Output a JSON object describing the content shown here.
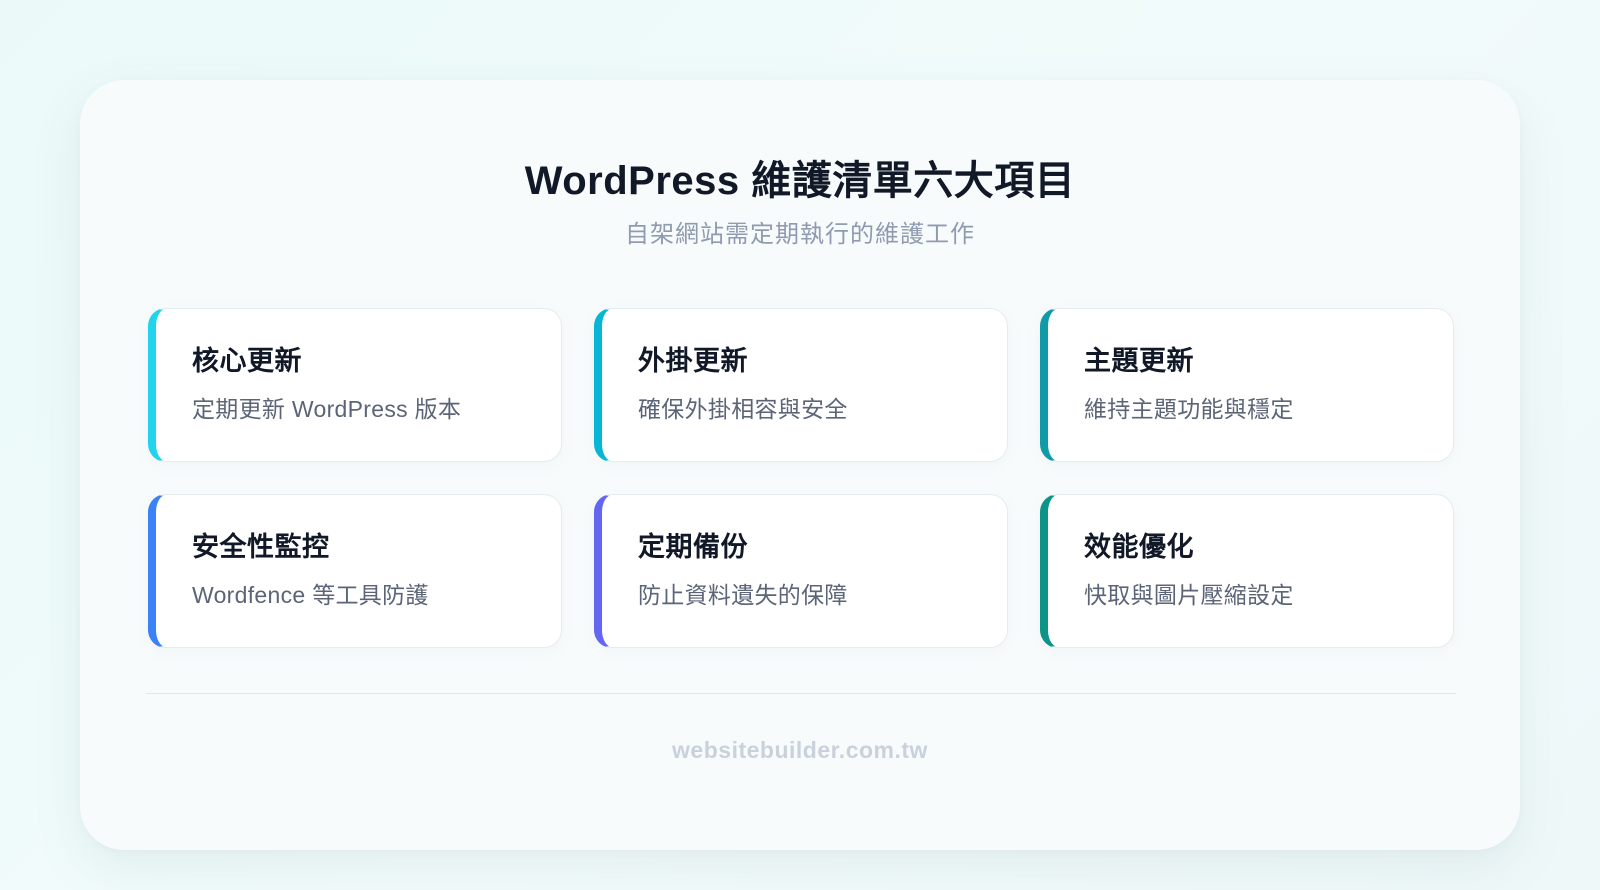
{
  "header": {
    "title": "WordPress 維護清單六大項目",
    "subtitle": "自架網站需定期執行的維護工作"
  },
  "cards": [
    {
      "title": "核心更新",
      "description": "定期更新 WordPress 版本",
      "accent": "#22d3ee"
    },
    {
      "title": "外掛更新",
      "description": "確保外掛相容與安全",
      "accent": "#06b6d4"
    },
    {
      "title": "主題更新",
      "description": "維持主題功能與穩定",
      "accent": "#0e9aa7"
    },
    {
      "title": "安全性監控",
      "description": "Wordfence 等工具防護",
      "accent": "#3b82f6"
    },
    {
      "title": "定期備份",
      "description": "防止資料遺失的保障",
      "accent": "#6366f1"
    },
    {
      "title": "效能優化",
      "description": "快取與圖片壓縮設定",
      "accent": "#0d9488"
    }
  ],
  "footer": {
    "text": "websitebuilder.com.tw"
  }
}
